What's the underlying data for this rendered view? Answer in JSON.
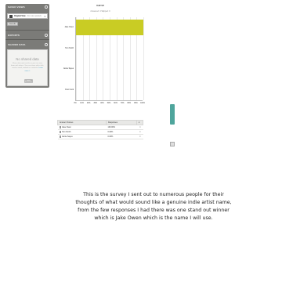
{
  "sidebar": {
    "saved_views_header": "SAVED VIEWS",
    "view_name": "Original View",
    "view_note": "(No rules applied)",
    "save_as_label": "Save As",
    "exports_header": "EXPORTS",
    "shared_data_header": "SHARED DATA",
    "shared_title": "No shared data",
    "shared_desc": "Share data and results so you can view them with others. You can share with a link, send in email, embed in a website.",
    "learn_more": "Learn more »",
    "share_button": "Share All"
  },
  "chart": {
    "title": "name",
    "subtitle": "Answered: 4    Skipped: 0"
  },
  "chart_data": {
    "type": "bar",
    "orientation": "horizontal",
    "title": "name",
    "categories": [
      "Jake Owen",
      "Tom Smith",
      "Jamie Sayes",
      "Fran Cook"
    ],
    "values": [
      100,
      0,
      0,
      0
    ],
    "xlim": [
      0,
      100
    ],
    "xticks": [
      "0%",
      "10%",
      "20%",
      "30%",
      "40%",
      "50%",
      "60%",
      "70%",
      "80%",
      "90%",
      "100%"
    ],
    "bar_color": "#c9cc24",
    "grid": true
  },
  "table": {
    "col_choices": "Answer Choices",
    "col_responses": "Responses",
    "rows": [
      {
        "choice": "Jake Owen",
        "response": "100.00%",
        "count": "4"
      },
      {
        "choice": "Tom Smith",
        "response": "0.00%",
        "count": "0"
      },
      {
        "choice": "Jamie Sayes",
        "response": "0.00%",
        "count": "0"
      }
    ]
  },
  "caption": "This is the survey I sent out to numerous people for their\nthoughts of what would sound like a genuine indie artist name,\nfrom the few responses I had there was one stand out winner\nwhich is Jake Owen which is the name I will use."
}
